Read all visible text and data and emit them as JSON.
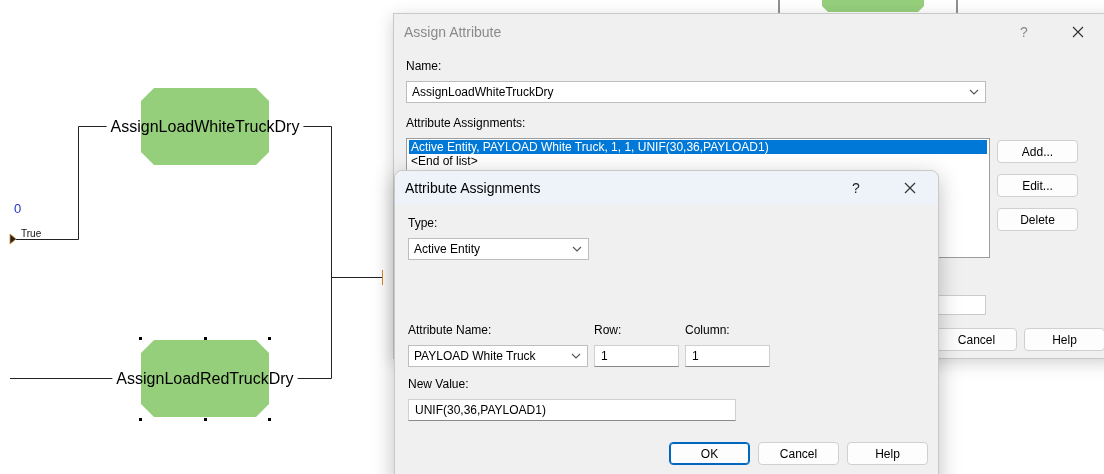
{
  "canvas": {
    "nodes": [
      {
        "label": "AssignLoadWhiteTruckDry",
        "selected": false
      },
      {
        "label": "AssignLoadRedTruckDry",
        "selected": true
      }
    ],
    "counter": "0",
    "branch_label": "True"
  },
  "assign_dialog": {
    "title": "Assign Attribute",
    "help": "?",
    "name_label": "Name:",
    "name_value": "AssignLoadWhiteTruckDry",
    "assignments_label": "Attribute Assignments:",
    "assignments": [
      {
        "text": "Active Entity, PAYLOAD White Truck, 1, 1, UNIF(30,36,PAYLOAD1)",
        "selected": true
      },
      {
        "text": "<End of list>",
        "selected": false
      }
    ],
    "side_buttons": [
      "Add...",
      "Edit...",
      "Delete"
    ],
    "footer_buttons": [
      "Cancel",
      "Help"
    ]
  },
  "attribute_dialog": {
    "title": "Attribute Assignments",
    "help": "?",
    "type_label": "Type:",
    "type_value": "Active Entity",
    "attribute_name_label": "Attribute Name:",
    "attribute_name_value": "PAYLOAD White Truck",
    "row_label": "Row:",
    "row_value": "1",
    "column_label": "Column:",
    "column_value": "1",
    "new_value_label": "New Value:",
    "new_value": "UNIF(30,36,PAYLOAD1)",
    "buttons": [
      {
        "label": "OK",
        "default": true
      },
      {
        "label": "Cancel",
        "default": false
      },
      {
        "label": "Help",
        "default": false
      }
    ]
  }
}
